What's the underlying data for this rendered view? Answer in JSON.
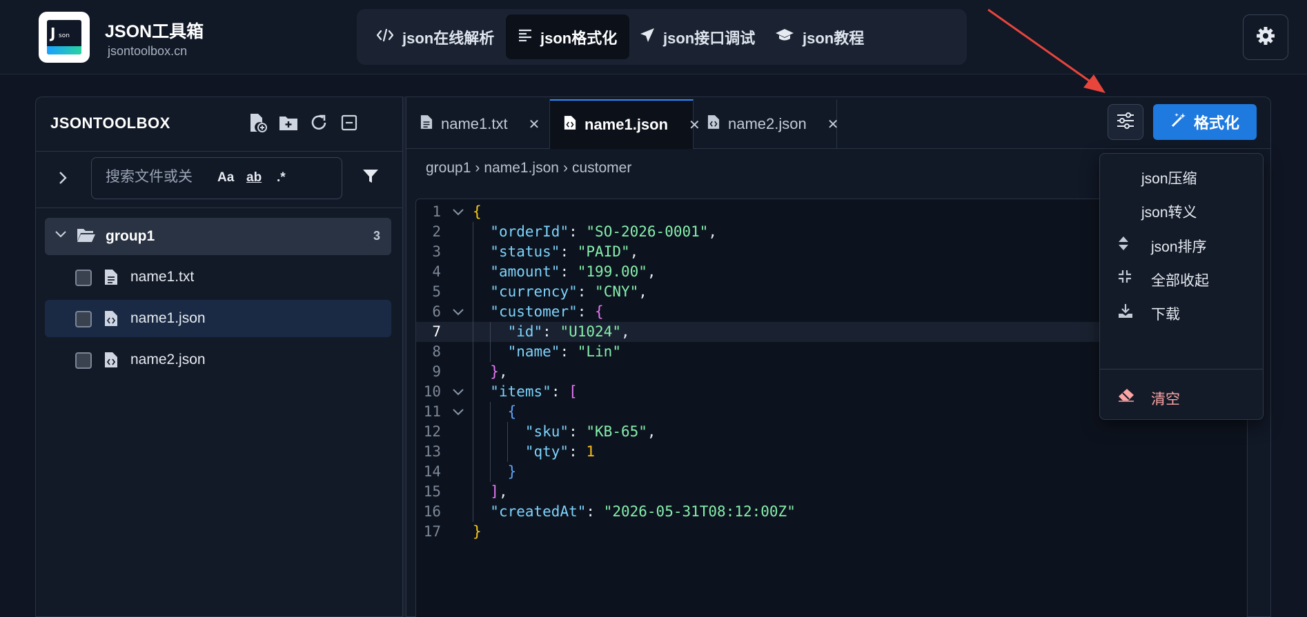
{
  "app": {
    "title": "JSON工具箱",
    "subtitle": "jsontoolbox.cn"
  },
  "nav": [
    {
      "label": "json在线解析",
      "icon": "code-icon"
    },
    {
      "label": "json格式化",
      "icon": "align-left-icon",
      "active": true
    },
    {
      "label": "json接口调试",
      "icon": "paper-plane-icon"
    },
    {
      "label": "json教程",
      "icon": "graduation-cap-icon"
    }
  ],
  "sidebar": {
    "title": "JSONTOOLBOX",
    "search": {
      "placeholder": "搜索文件或关",
      "opt_case": "Aa",
      "opt_word": "ab",
      "opt_regex": ".*"
    },
    "group": {
      "name": "group1",
      "count": "3"
    },
    "files": [
      {
        "name": "name1.txt",
        "type": "txt"
      },
      {
        "name": "name1.json",
        "type": "json",
        "selected": true
      },
      {
        "name": "name2.json",
        "type": "json"
      }
    ]
  },
  "tabs": [
    {
      "label": "name1.txt",
      "type": "txt"
    },
    {
      "label": "name1.json",
      "type": "json",
      "active": true
    },
    {
      "label": "name2.json",
      "type": "json"
    }
  ],
  "toolbar": {
    "format_label": "格式化"
  },
  "breadcrumb": {
    "group": "group1",
    "file": "name1.json",
    "node": "customer",
    "sep": "›"
  },
  "code": {
    "current_line": 7,
    "lines": [
      "{",
      "  \"orderId\": \"SO-2026-0001\",",
      "  \"status\": \"PAID\",",
      "  \"amount\": \"199.00\",",
      "  \"currency\": \"CNY\",",
      "  \"customer\": {",
      "    \"id\": \"U1024\",",
      "    \"name\": \"Lin\"",
      "  },",
      "  \"items\": [",
      "    {",
      "      \"sku\": \"KB-65\",",
      "      \"qty\": 1",
      "    }",
      "  ],",
      "  \"createdAt\": \"2026-05-31T08:12:00Z\"",
      "}"
    ]
  },
  "menu": [
    {
      "label": "json压缩",
      "icon": ""
    },
    {
      "label": "json转义",
      "icon": ""
    },
    {
      "label": "json排序",
      "icon": "sort-icon"
    },
    {
      "label": "全部收起",
      "icon": "collapse-icon"
    },
    {
      "label": "下载",
      "icon": "download-icon"
    },
    {
      "label": "清空",
      "icon": "eraser-icon"
    }
  ],
  "colors": {
    "accent": "#1f7ae0",
    "annotation_arrow": "#e8453c"
  }
}
